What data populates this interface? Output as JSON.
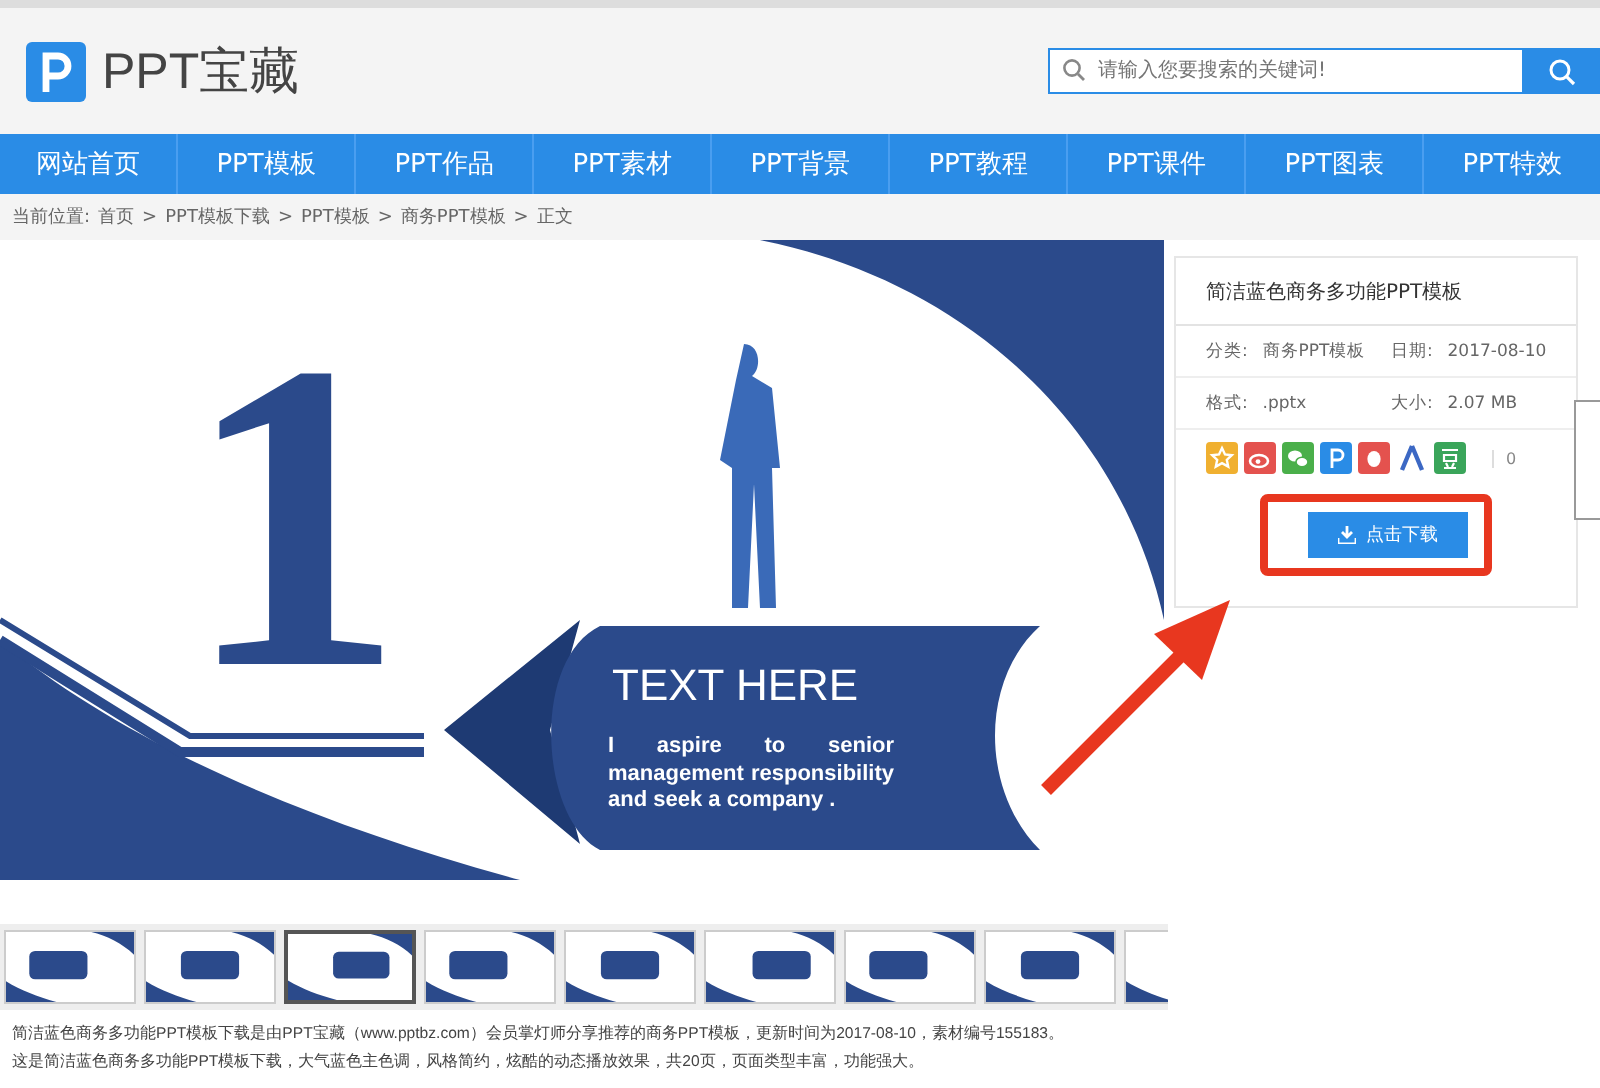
{
  "header": {
    "logo_text": "PPT宝藏",
    "search": {
      "placeholder": "请输入您要搜索的关键词!"
    }
  },
  "nav": [
    {
      "label": "网站首页",
      "selected": false
    },
    {
      "label": "PPT模板",
      "selected": false
    },
    {
      "label": "PPT作品",
      "selected": false
    },
    {
      "label": "PPT素材",
      "selected": false
    },
    {
      "label": "PPT背景",
      "selected": false
    },
    {
      "label": "PPT教程",
      "selected": false
    },
    {
      "label": "PPT课件",
      "selected": false
    },
    {
      "label": "PPT图表",
      "selected": false
    },
    {
      "label": "PPT特效",
      "selected": false
    }
  ],
  "breadcrumb": {
    "label": "当前位置:",
    "separator": ">",
    "items": [
      "首页",
      "PPT模板下载",
      "PPT模板",
      "商务PPT模板",
      "正文"
    ]
  },
  "slide": {
    "number": "1",
    "heading": "TEXT HERE",
    "body": "I aspire to senior management responsibility and seek a company ."
  },
  "thumbnails": [
    {
      "selected": false
    },
    {
      "selected": false
    },
    {
      "selected": true
    },
    {
      "selected": false
    },
    {
      "selected": false
    },
    {
      "selected": false
    },
    {
      "selected": false
    },
    {
      "selected": false
    },
    {
      "selected": false
    }
  ],
  "description": [
    "简洁蓝色商务多功能PPT模板下载是由PPT宝藏（www.pptbz.com）会员掌灯师分享推荐的商务PPT模板，更新时间为2017-08-10，素材编号155183。",
    "这是简洁蓝色商务多功能PPT模板下载，大气蓝色主色调，风格简约，炫酷的动态播放效果，共20页，页面类型丰富，功能强大。"
  ],
  "info": {
    "title": "简洁蓝色商务多功能PPT模板",
    "rows": [
      [
        {
          "label": "分类:",
          "value": "商务PPT模板"
        },
        {
          "label": "日期:",
          "value": "2017-08-10"
        }
      ],
      [
        {
          "label": "格式:",
          "value": ".pptx"
        },
        {
          "label": "大小:",
          "value": "2.07 MB"
        }
      ]
    ],
    "share_count": "0",
    "download": "点击下载"
  }
}
